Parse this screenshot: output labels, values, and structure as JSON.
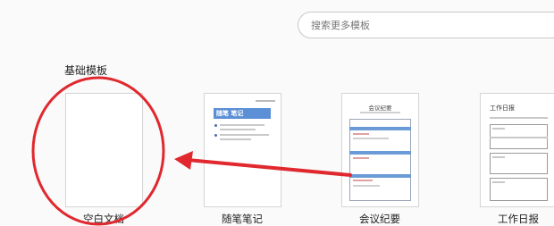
{
  "search": {
    "placeholder": "搜索更多模板"
  },
  "section": {
    "title": "基础模板"
  },
  "templates": [
    {
      "label": "空白文档"
    },
    {
      "label": "随笔笔记",
      "preview_title": "随笔 笔记"
    },
    {
      "label": "会议纪要",
      "preview_title": "会议纪要"
    },
    {
      "label": "工作日报",
      "preview_title": "工作日报"
    }
  ],
  "colors": {
    "annotation": "#e0282e",
    "accent_blue": "#5b8fd6"
  }
}
